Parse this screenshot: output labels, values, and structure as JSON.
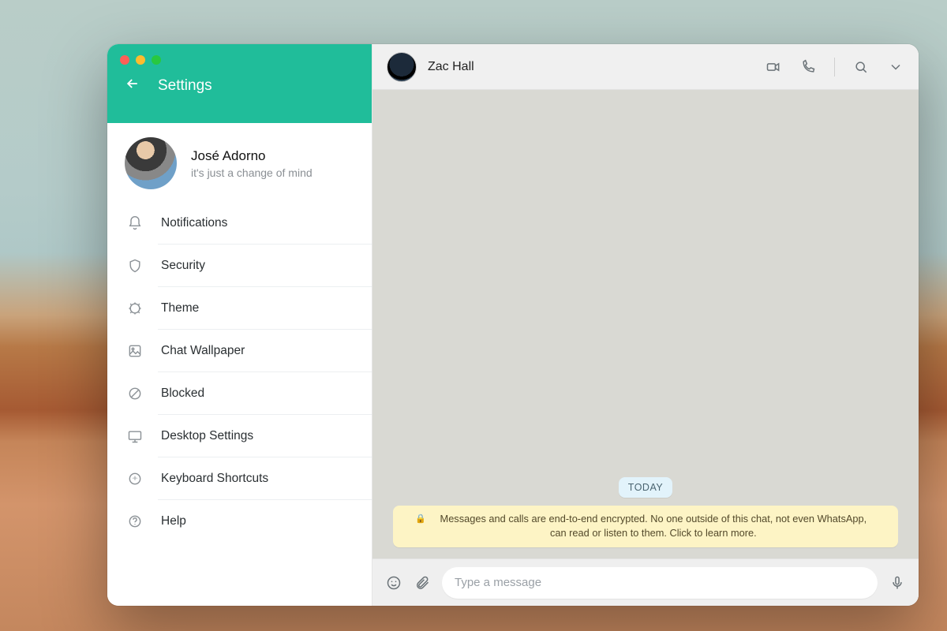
{
  "settings": {
    "title": "Settings"
  },
  "profile": {
    "name": "José Adorno",
    "status": "it's just a change of mind"
  },
  "menu": {
    "notifications": "Notifications",
    "security": "Security",
    "theme": "Theme",
    "wallpaper": "Chat Wallpaper",
    "blocked": "Blocked",
    "desktop": "Desktop Settings",
    "shortcuts": "Keyboard Shortcuts",
    "help": "Help"
  },
  "chat": {
    "contact_name": "Zac Hall",
    "date_label": "TODAY",
    "encryption_notice": "Messages and calls are end-to-end encrypted. No one outside of this chat, not even WhatsApp, can read or listen to them. Click to learn more.",
    "input_placeholder": "Type a message"
  },
  "colors": {
    "accent": "#20bd9a",
    "banner": "#fdf4c5",
    "date_pill": "#e2f3fb",
    "chat_bg": "#d9d9d3"
  }
}
